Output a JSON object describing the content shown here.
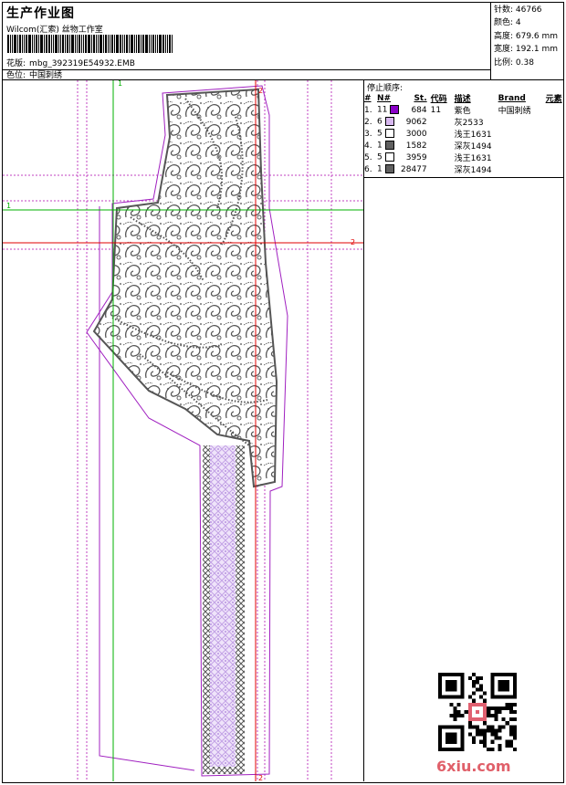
{
  "header": {
    "title": "生产作业图",
    "software": "Wilcom(汇索) 丝物工作室",
    "file_label": "花版:",
    "file_name": "mbg_392319E54932.EMB",
    "position_label": "色位:",
    "position_value": "中国刺绣"
  },
  "stats": {
    "stitches": "针数: 46766",
    "colors": "颜色: 4",
    "height": "高度: 679.6 mm",
    "width": "宽度: 192.1 mm",
    "scale": "比例: 0.38"
  },
  "stop_sequence": {
    "title": "停止顺序:",
    "headers": [
      "#",
      "N#",
      "St.",
      "代码",
      "描述",
      "Brand",
      "元素"
    ],
    "rows": [
      {
        "idx": "1.",
        "n": "11",
        "color": "#8a00c8",
        "stitches": "684",
        "code": "11",
        "desc": "紫色",
        "brand": "中国刺绣"
      },
      {
        "idx": "2.",
        "n": "6",
        "color": "#d8b8f0",
        "stitches": "9062",
        "code": "",
        "desc": "灰2533",
        "brand": ""
      },
      {
        "idx": "3.",
        "n": "5",
        "color": "#ffffff",
        "stitches": "3000",
        "code": "",
        "desc": "浅王1631",
        "brand": ""
      },
      {
        "idx": "4.",
        "n": "1",
        "color": "#606060",
        "stitches": "1582",
        "code": "",
        "desc": "深灰1494",
        "brand": ""
      },
      {
        "idx": "5.",
        "n": "5",
        "color": "#ffffff",
        "stitches": "3959",
        "code": "",
        "desc": "浅王1631",
        "brand": ""
      },
      {
        "idx": "6.",
        "n": "1",
        "color": "#606060",
        "stitches": "28477",
        "code": "",
        "desc": "深灰1494",
        "brand": ""
      }
    ]
  },
  "guides": {
    "label_1": "1",
    "label_2": "2"
  },
  "watermark": "6xiu.com",
  "colors": {
    "guide_purple": "#c040c0",
    "guide_green": "#00b000",
    "guide_red": "#e00000",
    "outline": "#a020c0",
    "stitch_dark": "#555555",
    "stitch_light": "#c8a8e8"
  }
}
